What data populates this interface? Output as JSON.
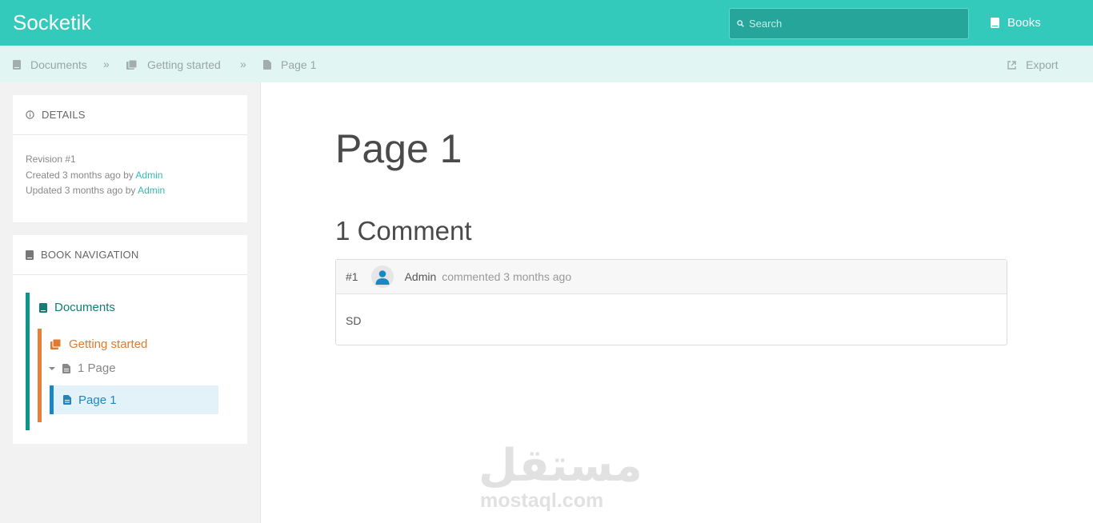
{
  "header": {
    "brand": "Socketik",
    "search_placeholder": "Search",
    "books_label": "Books"
  },
  "breadcrumb": {
    "items": [
      {
        "label": "Documents",
        "icon": "book-icon"
      },
      {
        "label": "Getting started",
        "icon": "chapter-icon"
      },
      {
        "label": "Page 1",
        "icon": "page-icon"
      }
    ],
    "separator": "»",
    "export_label": "Export"
  },
  "details": {
    "title": "DETAILS",
    "revision": "Revision #1",
    "created_prefix": "Created 3 months ago by ",
    "created_by": "Admin",
    "updated_prefix": "Updated 3 months ago by ",
    "updated_by": "Admin"
  },
  "book_nav": {
    "title": "BOOK NAVIGATION",
    "book": "Documents",
    "chapter": "Getting started",
    "pages_toggle": "1 Page",
    "current_page": "Page 1"
  },
  "main": {
    "page_title": "Page 1",
    "comments_title": "1 Comment",
    "comment": {
      "number": "#1",
      "author": "Admin",
      "meta": "commented 3 months ago",
      "body": "SD"
    }
  },
  "watermark": {
    "arabic": "مستقل",
    "latin": "mostaql.com"
  },
  "colors": {
    "header_bg": "#33cabb",
    "breadcrumb_bg": "#e1f6f3",
    "book_accent": "#0f9488",
    "chapter_accent": "#ea7e36",
    "page_accent": "#1a87c4"
  }
}
